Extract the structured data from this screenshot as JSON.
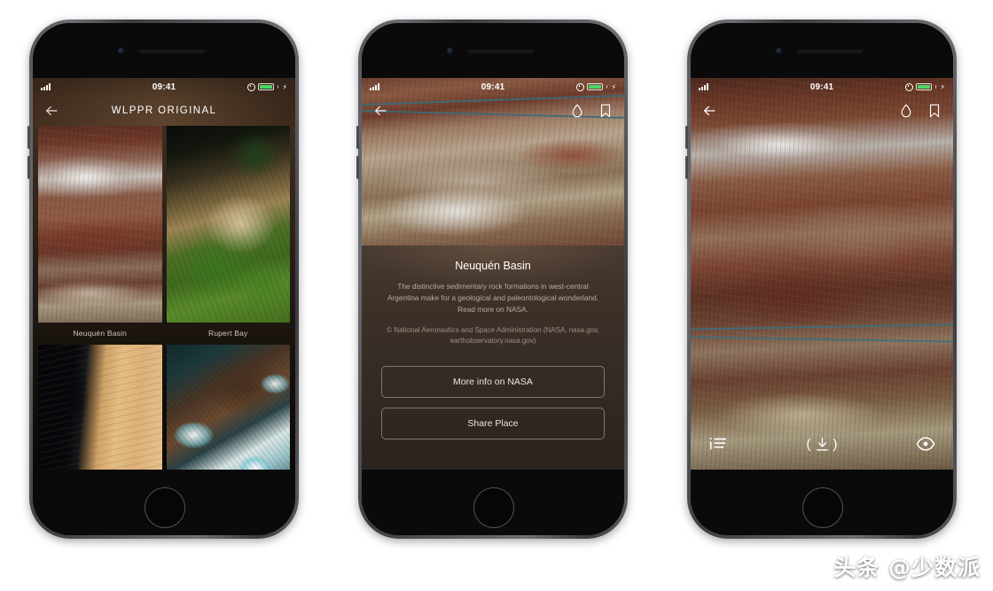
{
  "app": {
    "title": "WLPPR ORIGINAL"
  },
  "status_bar": {
    "time": "09:41",
    "battery_color": "#4cd964"
  },
  "phone1": {
    "nav": {
      "back_icon": "back-arrow-icon",
      "title": "WLPPR ORIGINAL"
    },
    "grid": [
      {
        "label": "Neuquén Basin",
        "thumb": "neuquen"
      },
      {
        "label": "Rupert Bay",
        "thumb": "rupert"
      },
      {
        "label": "",
        "thumb": "dunes"
      },
      {
        "label": "",
        "thumb": "salt"
      }
    ]
  },
  "phone2": {
    "nav": {
      "back_icon": "back-arrow-icon",
      "water_icon": "water-drop-icon",
      "bookmark_icon": "bookmark-icon"
    },
    "detail": {
      "title": "Neuquén Basin",
      "description": "The distinctive sedimentary rock formations in west-central Argentina make for a geological and paleontological wonderland. Read more on NASA.",
      "credit": "© National Aeronautics and Space Administration (NASA, nasa.gov, earthobservatory.nasa.gov)"
    },
    "buttons": {
      "more_info": "More info on NASA",
      "share": "Share Place"
    }
  },
  "phone3": {
    "nav": {
      "back_icon": "back-arrow-icon",
      "water_icon": "water-drop-icon",
      "bookmark_icon": "bookmark-icon"
    },
    "toolbar": {
      "info_icon": "info-list-icon",
      "download_icon": "download-icon",
      "eye_icon": "eye-icon"
    }
  },
  "watermark": {
    "text": "头条 @少数派"
  }
}
